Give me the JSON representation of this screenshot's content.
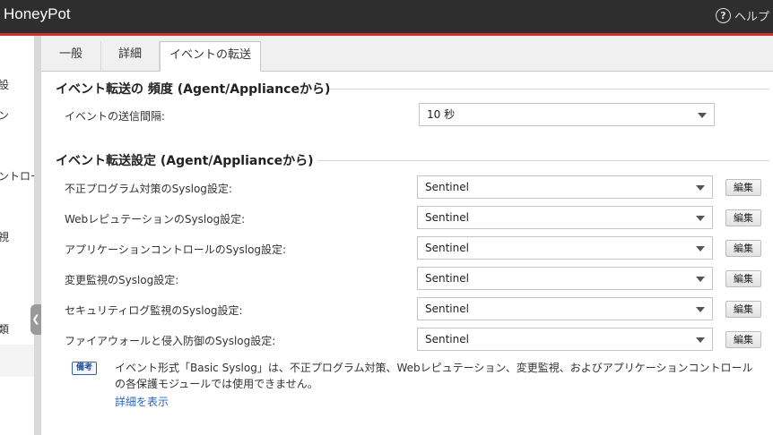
{
  "app": {
    "title": "HoneyPot",
    "help_label": "ヘルプ",
    "help_icon": "question-circle-icon"
  },
  "sidebar": {
    "items": [
      {
        "label": "設"
      },
      {
        "label": "ン"
      },
      {
        "label": "ントロー"
      },
      {
        "label": "視"
      },
      {
        "label": "類"
      }
    ],
    "collapse_icon": "chevron-left-icon"
  },
  "tabs": [
    {
      "label": "一般"
    },
    {
      "label": "詳細"
    },
    {
      "label": "イベントの転送"
    }
  ],
  "active_tab": "イベントの転送",
  "frequency": {
    "title": "イベント転送の 頻度 (Agent/Applianceから)",
    "label": "イベントの送信間隔:",
    "value": "10 秒"
  },
  "forwarding": {
    "title": "イベント転送設定 (Agent/Applianceから)",
    "edit_label": "編集",
    "rows": [
      {
        "label": "不正プログラム対策のSyslog設定:",
        "value": "Sentinel"
      },
      {
        "label": "WebレピュテーションのSyslog設定:",
        "value": "Sentinel"
      },
      {
        "label": "アプリケーションコントロールのSyslog設定:",
        "value": "Sentinel"
      },
      {
        "label": "変更監視のSyslog設定:",
        "value": "Sentinel"
      },
      {
        "label": "セキュリティログ監視のSyslog設定:",
        "value": "Sentinel"
      },
      {
        "label": "ファイアウォールと侵入防御のSyslog設定:",
        "value": "Sentinel"
      }
    ]
  },
  "note": {
    "badge": "備考",
    "text": "イベント形式「Basic Syslog」は、不正プログラム対策、Webレピュテーション、変更監視、およびアプリケーションコントロールの各保護モジュールでは使用できません。",
    "link": "詳細を表示"
  },
  "colors": {
    "topbar": "#2e2e2e",
    "accent_red": "#d32f2f",
    "link": "#2a66b8"
  }
}
